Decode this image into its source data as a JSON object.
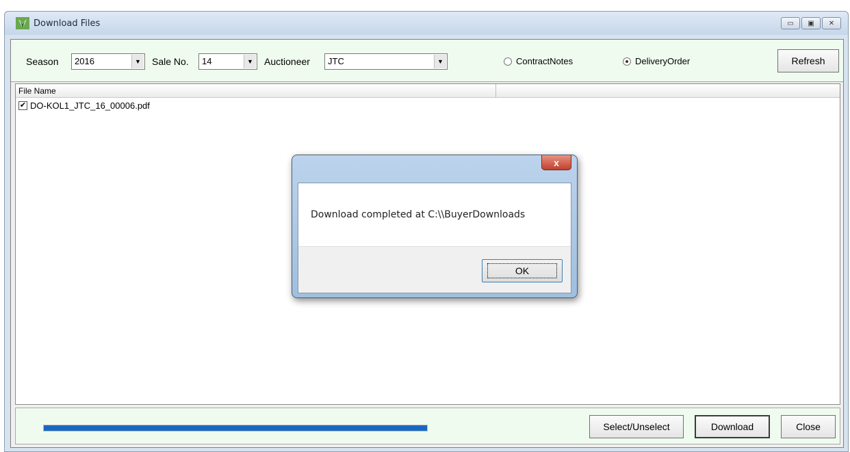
{
  "window": {
    "title": "Download Files",
    "controls": [
      "▭",
      "▣",
      "✕"
    ]
  },
  "toolbar": {
    "season_label": "Season",
    "season_value": "2016",
    "sale_label": "Sale No.",
    "sale_value": "14",
    "auctioneer_label": "Auctioneer",
    "auctioneer_value": "JTC",
    "radio_contract": "ContractNotes",
    "radio_delivery": "DeliveryOrder",
    "radio_selected": "DeliveryOrder",
    "refresh_label": "Refresh"
  },
  "list": {
    "columns": [
      "File Name",
      ""
    ],
    "rows": [
      {
        "checked": true,
        "check_glyph": "✔",
        "name": "DO-KOL1_JTC_16_00006.pdf"
      }
    ]
  },
  "footer": {
    "progress": 1.0,
    "progress_color": "#1a67c2",
    "select_label": "Select/Unselect",
    "download_label": "Download",
    "close_label": "Close"
  },
  "dialog": {
    "close_glyph": "x",
    "message": "Download completed at C:\\\\BuyerDownloads",
    "ok_label": "OK"
  }
}
